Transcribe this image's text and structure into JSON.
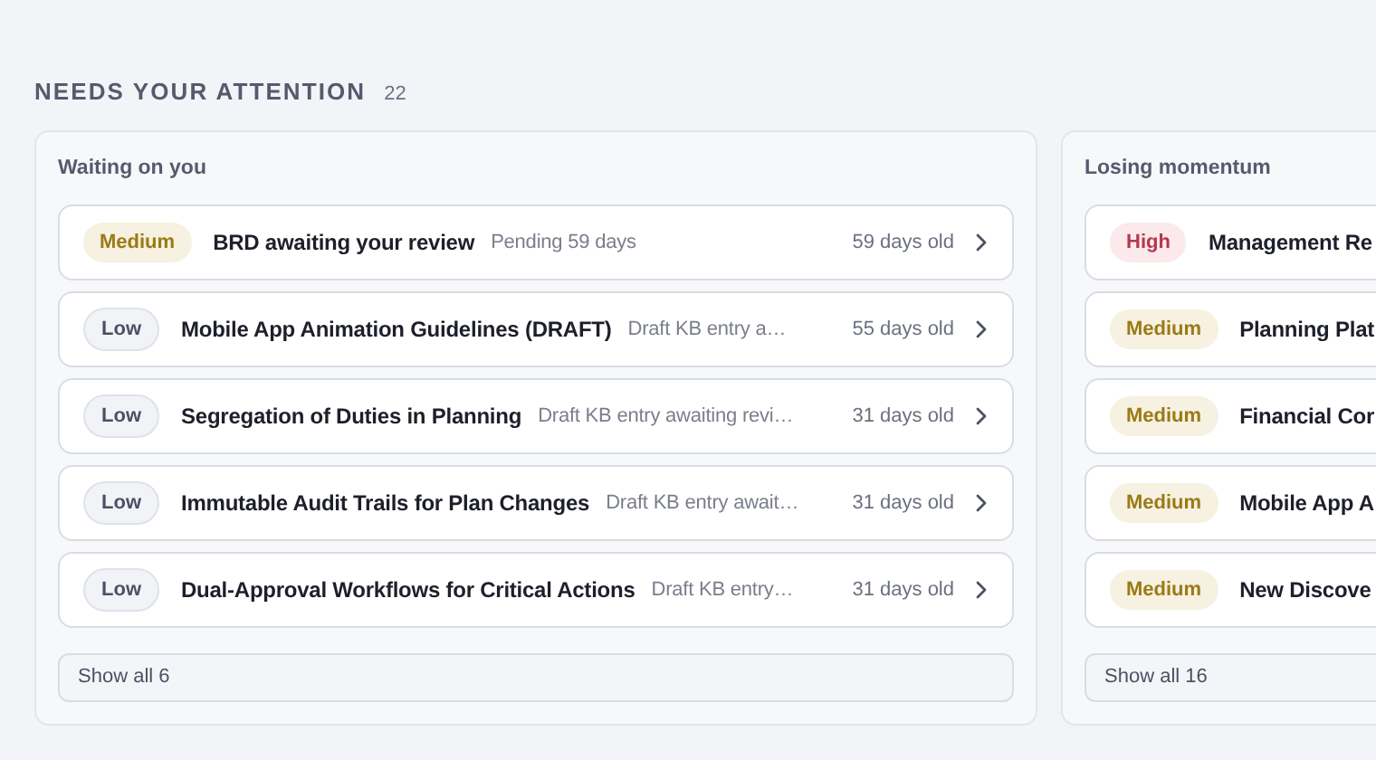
{
  "section": {
    "title": "NEEDS YOUR ATTENTION",
    "count": "22"
  },
  "panels": [
    {
      "title": "Waiting on you",
      "items": [
        {
          "kind": "medium",
          "priority": "Medium",
          "title": "BRD awaiting your review",
          "detail": "Pending 59 days",
          "age": "59 days old"
        },
        {
          "kind": "low",
          "priority": "Low",
          "title": "Mobile App Animation Guidelines (DRAFT)",
          "detail": "Draft KB entry a…",
          "age": "55 days old"
        },
        {
          "kind": "low",
          "priority": "Low",
          "title": "Segregation of Duties in Planning",
          "detail": "Draft KB entry awaiting revi…",
          "age": "31 days old"
        },
        {
          "kind": "low",
          "priority": "Low",
          "title": "Immutable Audit Trails for Plan Changes",
          "detail": "Draft KB entry await…",
          "age": "31 days old"
        },
        {
          "kind": "low",
          "priority": "Low",
          "title": "Dual-Approval Workflows for Critical Actions",
          "detail": "Draft KB entry…",
          "age": "31 days old"
        }
      ],
      "show_all": "Show all 6"
    },
    {
      "title": "Losing momentum",
      "items": [
        {
          "kind": "high",
          "priority": "High",
          "title": "Management Re"
        },
        {
          "kind": "medium",
          "priority": "Medium",
          "title": "Planning Plat"
        },
        {
          "kind": "medium",
          "priority": "Medium",
          "title": "Financial Cor"
        },
        {
          "kind": "medium",
          "priority": "Medium",
          "title": "Mobile App A"
        },
        {
          "kind": "medium",
          "priority": "Medium",
          "title": "New Discove"
        }
      ],
      "show_all": "Show all 16"
    }
  ]
}
